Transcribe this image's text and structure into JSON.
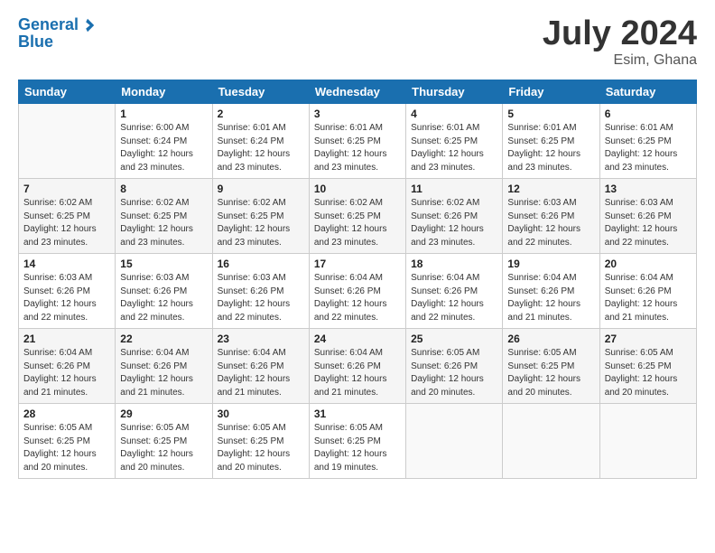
{
  "header": {
    "logo_line1": "General",
    "logo_line2": "Blue",
    "month_year": "July 2024",
    "location": "Esim, Ghana"
  },
  "columns": [
    "Sunday",
    "Monday",
    "Tuesday",
    "Wednesday",
    "Thursday",
    "Friday",
    "Saturday"
  ],
  "weeks": [
    [
      {
        "day": "",
        "info": ""
      },
      {
        "day": "1",
        "info": "Sunrise: 6:00 AM\nSunset: 6:24 PM\nDaylight: 12 hours\nand 23 minutes."
      },
      {
        "day": "2",
        "info": "Sunrise: 6:01 AM\nSunset: 6:24 PM\nDaylight: 12 hours\nand 23 minutes."
      },
      {
        "day": "3",
        "info": "Sunrise: 6:01 AM\nSunset: 6:25 PM\nDaylight: 12 hours\nand 23 minutes."
      },
      {
        "day": "4",
        "info": "Sunrise: 6:01 AM\nSunset: 6:25 PM\nDaylight: 12 hours\nand 23 minutes."
      },
      {
        "day": "5",
        "info": "Sunrise: 6:01 AM\nSunset: 6:25 PM\nDaylight: 12 hours\nand 23 minutes."
      },
      {
        "day": "6",
        "info": "Sunrise: 6:01 AM\nSunset: 6:25 PM\nDaylight: 12 hours\nand 23 minutes."
      }
    ],
    [
      {
        "day": "7",
        "info": "Sunrise: 6:02 AM\nSunset: 6:25 PM\nDaylight: 12 hours\nand 23 minutes."
      },
      {
        "day": "8",
        "info": "Sunrise: 6:02 AM\nSunset: 6:25 PM\nDaylight: 12 hours\nand 23 minutes."
      },
      {
        "day": "9",
        "info": "Sunrise: 6:02 AM\nSunset: 6:25 PM\nDaylight: 12 hours\nand 23 minutes."
      },
      {
        "day": "10",
        "info": "Sunrise: 6:02 AM\nSunset: 6:25 PM\nDaylight: 12 hours\nand 23 minutes."
      },
      {
        "day": "11",
        "info": "Sunrise: 6:02 AM\nSunset: 6:26 PM\nDaylight: 12 hours\nand 23 minutes."
      },
      {
        "day": "12",
        "info": "Sunrise: 6:03 AM\nSunset: 6:26 PM\nDaylight: 12 hours\nand 22 minutes."
      },
      {
        "day": "13",
        "info": "Sunrise: 6:03 AM\nSunset: 6:26 PM\nDaylight: 12 hours\nand 22 minutes."
      }
    ],
    [
      {
        "day": "14",
        "info": "Sunrise: 6:03 AM\nSunset: 6:26 PM\nDaylight: 12 hours\nand 22 minutes."
      },
      {
        "day": "15",
        "info": "Sunrise: 6:03 AM\nSunset: 6:26 PM\nDaylight: 12 hours\nand 22 minutes."
      },
      {
        "day": "16",
        "info": "Sunrise: 6:03 AM\nSunset: 6:26 PM\nDaylight: 12 hours\nand 22 minutes."
      },
      {
        "day": "17",
        "info": "Sunrise: 6:04 AM\nSunset: 6:26 PM\nDaylight: 12 hours\nand 22 minutes."
      },
      {
        "day": "18",
        "info": "Sunrise: 6:04 AM\nSunset: 6:26 PM\nDaylight: 12 hours\nand 22 minutes."
      },
      {
        "day": "19",
        "info": "Sunrise: 6:04 AM\nSunset: 6:26 PM\nDaylight: 12 hours\nand 21 minutes."
      },
      {
        "day": "20",
        "info": "Sunrise: 6:04 AM\nSunset: 6:26 PM\nDaylight: 12 hours\nand 21 minutes."
      }
    ],
    [
      {
        "day": "21",
        "info": "Sunrise: 6:04 AM\nSunset: 6:26 PM\nDaylight: 12 hours\nand 21 minutes."
      },
      {
        "day": "22",
        "info": "Sunrise: 6:04 AM\nSunset: 6:26 PM\nDaylight: 12 hours\nand 21 minutes."
      },
      {
        "day": "23",
        "info": "Sunrise: 6:04 AM\nSunset: 6:26 PM\nDaylight: 12 hours\nand 21 minutes."
      },
      {
        "day": "24",
        "info": "Sunrise: 6:04 AM\nSunset: 6:26 PM\nDaylight: 12 hours\nand 21 minutes."
      },
      {
        "day": "25",
        "info": "Sunrise: 6:05 AM\nSunset: 6:26 PM\nDaylight: 12 hours\nand 20 minutes."
      },
      {
        "day": "26",
        "info": "Sunrise: 6:05 AM\nSunset: 6:25 PM\nDaylight: 12 hours\nand 20 minutes."
      },
      {
        "day": "27",
        "info": "Sunrise: 6:05 AM\nSunset: 6:25 PM\nDaylight: 12 hours\nand 20 minutes."
      }
    ],
    [
      {
        "day": "28",
        "info": "Sunrise: 6:05 AM\nSunset: 6:25 PM\nDaylight: 12 hours\nand 20 minutes."
      },
      {
        "day": "29",
        "info": "Sunrise: 6:05 AM\nSunset: 6:25 PM\nDaylight: 12 hours\nand 20 minutes."
      },
      {
        "day": "30",
        "info": "Sunrise: 6:05 AM\nSunset: 6:25 PM\nDaylight: 12 hours\nand 20 minutes."
      },
      {
        "day": "31",
        "info": "Sunrise: 6:05 AM\nSunset: 6:25 PM\nDaylight: 12 hours\nand 19 minutes."
      },
      {
        "day": "",
        "info": ""
      },
      {
        "day": "",
        "info": ""
      },
      {
        "day": "",
        "info": ""
      }
    ]
  ]
}
